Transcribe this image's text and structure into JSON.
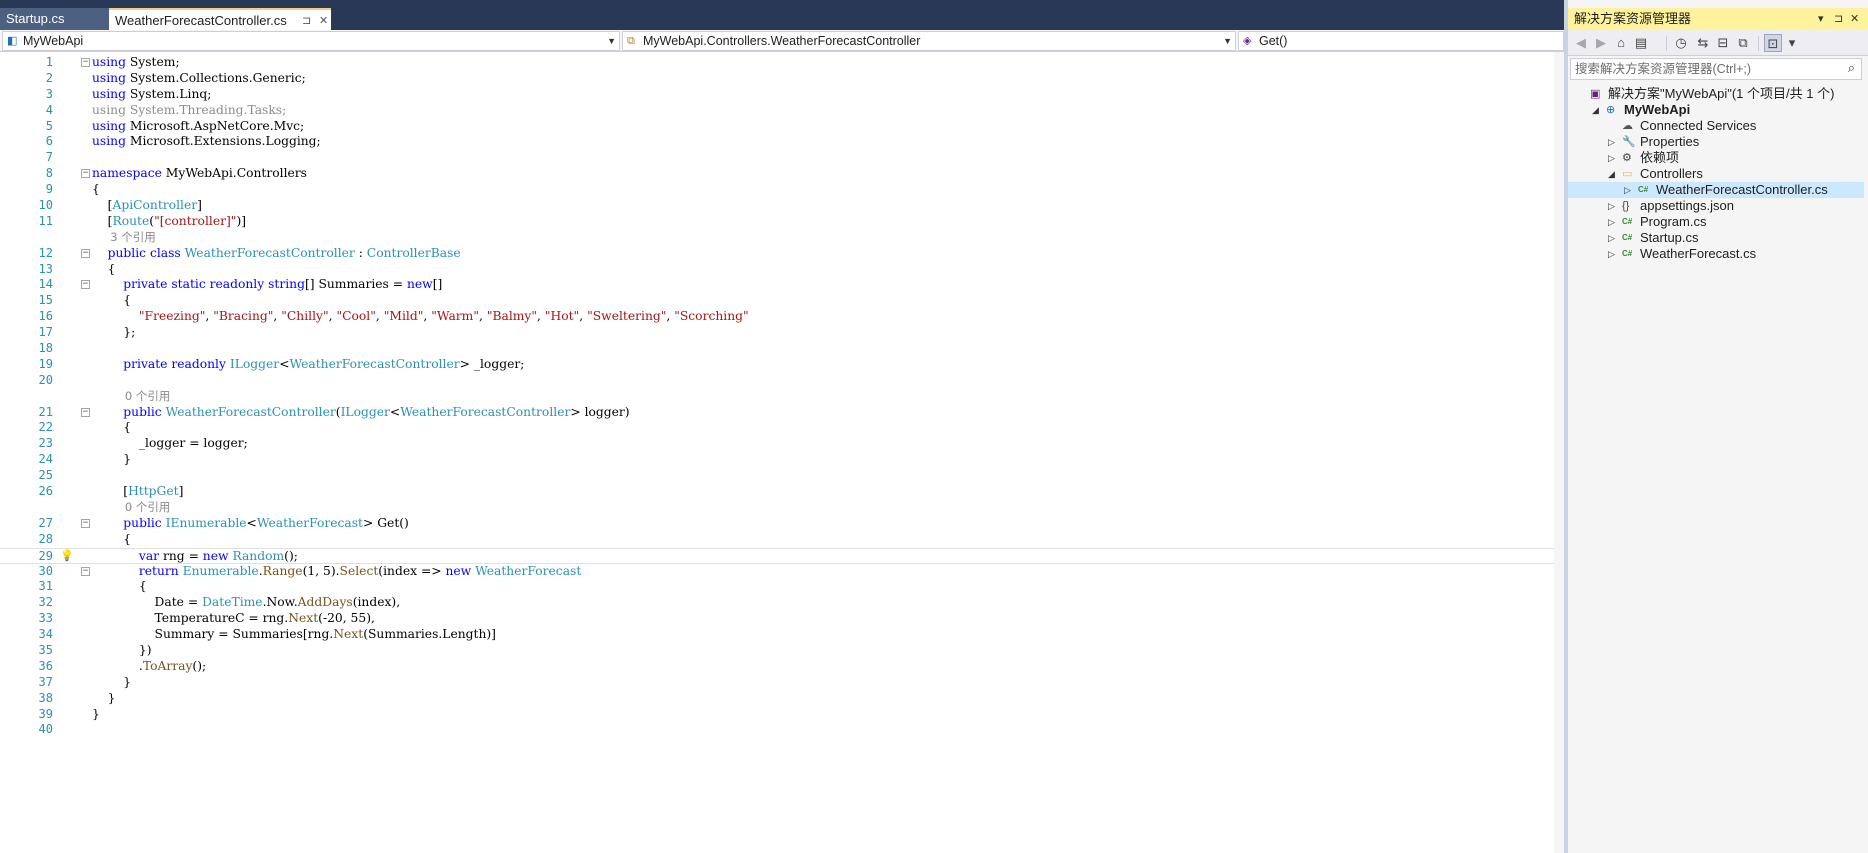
{
  "tabs": {
    "inactive": "Startup.cs",
    "active": "WeatherForecastController.cs",
    "pin_glyph": "⊐",
    "close_glyph": "✕"
  },
  "navbar": {
    "project": "MyWebApi",
    "class": "MyWebApi.Controllers.WeatherForecastController",
    "member": "Get()"
  },
  "code_lines": [
    {
      "n": "1",
      "fold": "−",
      "segs": [
        {
          "c": "kw",
          "t": "using"
        },
        {
          "c": "",
          "t": " System;"
        }
      ]
    },
    {
      "n": "2",
      "segs": [
        {
          "c": "kw",
          "t": "using"
        },
        {
          "c": "",
          "t": " System.Collections.Generic;"
        }
      ]
    },
    {
      "n": "3",
      "segs": [
        {
          "c": "kw",
          "t": "using"
        },
        {
          "c": "",
          "t": " System.Linq;"
        }
      ]
    },
    {
      "n": "4",
      "segs": [
        {
          "c": "dim",
          "t": "using System.Threading.Tasks;"
        }
      ]
    },
    {
      "n": "5",
      "segs": [
        {
          "c": "kw",
          "t": "using"
        },
        {
          "c": "",
          "t": " Microsoft.AspNetCore.Mvc;"
        }
      ]
    },
    {
      "n": "6",
      "segs": [
        {
          "c": "kw",
          "t": "using"
        },
        {
          "c": "",
          "t": " Microsoft.Extensions.Logging;"
        }
      ]
    },
    {
      "n": "7",
      "segs": []
    },
    {
      "n": "8",
      "fold": "−",
      "segs": [
        {
          "c": "kw",
          "t": "namespace"
        },
        {
          "c": "",
          "t": " MyWebApi.Controllers"
        }
      ]
    },
    {
      "n": "9",
      "segs": [
        {
          "c": "",
          "t": "{"
        }
      ]
    },
    {
      "n": "10",
      "segs": [
        {
          "c": "",
          "t": "    ["
        },
        {
          "c": "ty",
          "t": "ApiController"
        },
        {
          "c": "",
          "t": "]"
        }
      ]
    },
    {
      "n": "11",
      "segs": [
        {
          "c": "",
          "t": "    ["
        },
        {
          "c": "ty",
          "t": "Route"
        },
        {
          "c": "",
          "t": "("
        },
        {
          "c": "st",
          "t": "\"[controller]\""
        },
        {
          "c": "",
          "t": ")]"
        }
      ]
    },
    {
      "n": "",
      "lens": true,
      "segs": [
        {
          "c": "",
          "t": "     3 个引用"
        }
      ]
    },
    {
      "n": "12",
      "fold": "−",
      "segs": [
        {
          "c": "",
          "t": "    "
        },
        {
          "c": "kw",
          "t": "public class"
        },
        {
          "c": "",
          "t": " "
        },
        {
          "c": "ty",
          "t": "WeatherForecastController"
        },
        {
          "c": "",
          "t": " : "
        },
        {
          "c": "ty",
          "t": "ControllerBase"
        }
      ]
    },
    {
      "n": "13",
      "segs": [
        {
          "c": "",
          "t": "    {"
        }
      ]
    },
    {
      "n": "14",
      "fold": "−",
      "segs": [
        {
          "c": "",
          "t": "        "
        },
        {
          "c": "kw",
          "t": "private static readonly string"
        },
        {
          "c": "",
          "t": "[] Summaries = "
        },
        {
          "c": "kw",
          "t": "new"
        },
        {
          "c": "",
          "t": "[]"
        }
      ]
    },
    {
      "n": "15",
      "segs": [
        {
          "c": "",
          "t": "        {"
        }
      ]
    },
    {
      "n": "16",
      "segs": [
        {
          "c": "",
          "t": "            "
        },
        {
          "c": "st",
          "t": "\"Freezing\""
        },
        {
          "c": "",
          "t": ", "
        },
        {
          "c": "st",
          "t": "\"Bracing\""
        },
        {
          "c": "",
          "t": ", "
        },
        {
          "c": "st",
          "t": "\"Chilly\""
        },
        {
          "c": "",
          "t": ", "
        },
        {
          "c": "st",
          "t": "\"Cool\""
        },
        {
          "c": "",
          "t": ", "
        },
        {
          "c": "st",
          "t": "\"Mild\""
        },
        {
          "c": "",
          "t": ", "
        },
        {
          "c": "st",
          "t": "\"Warm\""
        },
        {
          "c": "",
          "t": ", "
        },
        {
          "c": "st",
          "t": "\"Balmy\""
        },
        {
          "c": "",
          "t": ", "
        },
        {
          "c": "st",
          "t": "\"Hot\""
        },
        {
          "c": "",
          "t": ", "
        },
        {
          "c": "st",
          "t": "\"Sweltering\""
        },
        {
          "c": "",
          "t": ", "
        },
        {
          "c": "st",
          "t": "\"Scorching\""
        }
      ]
    },
    {
      "n": "17",
      "segs": [
        {
          "c": "",
          "t": "        };"
        }
      ]
    },
    {
      "n": "18",
      "segs": []
    },
    {
      "n": "19",
      "segs": [
        {
          "c": "",
          "t": "        "
        },
        {
          "c": "kw",
          "t": "private readonly"
        },
        {
          "c": "",
          "t": " "
        },
        {
          "c": "ty",
          "t": "ILogger"
        },
        {
          "c": "",
          "t": "<"
        },
        {
          "c": "ty",
          "t": "WeatherForecastController"
        },
        {
          "c": "",
          "t": "> _logger;"
        }
      ]
    },
    {
      "n": "20",
      "segs": []
    },
    {
      "n": "",
      "lens": true,
      "segs": [
        {
          "c": "",
          "t": "         0 个引用"
        }
      ]
    },
    {
      "n": "21",
      "fold": "−",
      "segs": [
        {
          "c": "",
          "t": "        "
        },
        {
          "c": "kw",
          "t": "public"
        },
        {
          "c": "",
          "t": " "
        },
        {
          "c": "ty",
          "t": "WeatherForecastController"
        },
        {
          "c": "",
          "t": "("
        },
        {
          "c": "ty",
          "t": "ILogger"
        },
        {
          "c": "",
          "t": "<"
        },
        {
          "c": "ty",
          "t": "WeatherForecastController"
        },
        {
          "c": "",
          "t": "> logger)"
        }
      ]
    },
    {
      "n": "22",
      "segs": [
        {
          "c": "",
          "t": "        {"
        }
      ]
    },
    {
      "n": "23",
      "segs": [
        {
          "c": "",
          "t": "            _logger = logger;"
        }
      ]
    },
    {
      "n": "24",
      "segs": [
        {
          "c": "",
          "t": "        }"
        }
      ]
    },
    {
      "n": "25",
      "segs": []
    },
    {
      "n": "26",
      "segs": [
        {
          "c": "",
          "t": "        ["
        },
        {
          "c": "ty",
          "t": "HttpGet"
        },
        {
          "c": "",
          "t": "]"
        }
      ]
    },
    {
      "n": "",
      "lens": true,
      "segs": [
        {
          "c": "",
          "t": "         0 个引用"
        }
      ]
    },
    {
      "n": "27",
      "fold": "−",
      "segs": [
        {
          "c": "",
          "t": "        "
        },
        {
          "c": "kw",
          "t": "public"
        },
        {
          "c": "",
          "t": " "
        },
        {
          "c": "ty",
          "t": "IEnumerable"
        },
        {
          "c": "",
          "t": "<"
        },
        {
          "c": "ty",
          "t": "WeatherForecast"
        },
        {
          "c": "",
          "t": "> Get()"
        }
      ]
    },
    {
      "n": "28",
      "segs": [
        {
          "c": "",
          "t": "        {"
        }
      ]
    },
    {
      "n": "29",
      "current": true,
      "segs": [
        {
          "c": "",
          "t": "            "
        },
        {
          "c": "kw",
          "t": "var"
        },
        {
          "c": "",
          "t": " rng = "
        },
        {
          "c": "kw",
          "t": "new"
        },
        {
          "c": "",
          "t": " "
        },
        {
          "c": "ty",
          "t": "Random"
        },
        {
          "c": "",
          "t": "();"
        }
      ]
    },
    {
      "n": "30",
      "fold": "−",
      "segs": [
        {
          "c": "",
          "t": "            "
        },
        {
          "c": "kw",
          "t": "return"
        },
        {
          "c": "",
          "t": " "
        },
        {
          "c": "ty",
          "t": "Enumerable"
        },
        {
          "c": "",
          "t": "."
        },
        {
          "c": "fn",
          "t": "Range"
        },
        {
          "c": "",
          "t": "(1, 5)."
        },
        {
          "c": "fn",
          "t": "Select"
        },
        {
          "c": "",
          "t": "(index => "
        },
        {
          "c": "kw",
          "t": "new"
        },
        {
          "c": "",
          "t": " "
        },
        {
          "c": "ty",
          "t": "WeatherForecast"
        }
      ]
    },
    {
      "n": "31",
      "segs": [
        {
          "c": "",
          "t": "            {"
        }
      ]
    },
    {
      "n": "32",
      "segs": [
        {
          "c": "",
          "t": "                Date = "
        },
        {
          "c": "ty",
          "t": "DateTime"
        },
        {
          "c": "",
          "t": ".Now."
        },
        {
          "c": "fn",
          "t": "AddDays"
        },
        {
          "c": "",
          "t": "(index),"
        }
      ]
    },
    {
      "n": "33",
      "segs": [
        {
          "c": "",
          "t": "                TemperatureC = rng."
        },
        {
          "c": "fn",
          "t": "Next"
        },
        {
          "c": "",
          "t": "(-20, 55),"
        }
      ]
    },
    {
      "n": "34",
      "segs": [
        {
          "c": "",
          "t": "                Summary = Summaries[rng."
        },
        {
          "c": "fn",
          "t": "Next"
        },
        {
          "c": "",
          "t": "(Summaries.Length)]"
        }
      ]
    },
    {
      "n": "35",
      "segs": [
        {
          "c": "",
          "t": "            })"
        }
      ]
    },
    {
      "n": "36",
      "segs": [
        {
          "c": "",
          "t": "            ."
        },
        {
          "c": "fn",
          "t": "ToArray"
        },
        {
          "c": "",
          "t": "();"
        }
      ]
    },
    {
      "n": "37",
      "segs": [
        {
          "c": "",
          "t": "        }"
        }
      ]
    },
    {
      "n": "38",
      "segs": [
        {
          "c": "",
          "t": "    }"
        }
      ]
    },
    {
      "n": "39",
      "segs": [
        {
          "c": "",
          "t": "}"
        }
      ]
    },
    {
      "n": "40",
      "segs": []
    }
  ],
  "solution_explorer": {
    "title": "解决方案资源管理器",
    "search_placeholder": "搜索解决方案资源管理器(Ctrl+;)",
    "tree": [
      {
        "label": "解决方案\"MyWebApi\"(1 个项目/共 1 个)",
        "depth": 0,
        "arrow": "",
        "icon": "solution-icon",
        "glyph": "▣",
        "color": "#68217a"
      },
      {
        "label": "MyWebApi",
        "depth": 1,
        "arrow": "◢",
        "icon": "web-project-icon",
        "glyph": "⊕",
        "color": "#1e6fbf",
        "bold": true
      },
      {
        "label": "Connected Services",
        "depth": 2,
        "arrow": "",
        "icon": "connected-services-icon",
        "glyph": "☁",
        "color": "#555555"
      },
      {
        "label": "Properties",
        "depth": 2,
        "arrow": "▷",
        "icon": "wrench-icon",
        "glyph": "🔧",
        "color": "#424242"
      },
      {
        "label": "依赖项",
        "depth": 2,
        "arrow": "▷",
        "icon": "dependencies-icon",
        "glyph": "⚙",
        "color": "#424242"
      },
      {
        "label": "Controllers",
        "depth": 2,
        "arrow": "◢",
        "icon": "folder-open-icon",
        "glyph": "▭",
        "color": "#dcb67a"
      },
      {
        "label": "WeatherForecastController.cs",
        "depth": 3,
        "arrow": "▷",
        "icon": "csharp-file-icon",
        "glyph": "C#",
        "color": "#388a34",
        "selected": true
      },
      {
        "label": "appsettings.json",
        "depth": 2,
        "arrow": "▷",
        "icon": "json-file-icon",
        "glyph": "{}",
        "color": "#424242"
      },
      {
        "label": "Program.cs",
        "depth": 2,
        "arrow": "▷",
        "icon": "csharp-file-icon",
        "glyph": "C#",
        "color": "#388a34"
      },
      {
        "label": "Startup.cs",
        "depth": 2,
        "arrow": "▷",
        "icon": "csharp-file-icon",
        "glyph": "C#",
        "color": "#388a34"
      },
      {
        "label": "WeatherForecast.cs",
        "depth": 2,
        "arrow": "▷",
        "icon": "csharp-file-icon",
        "glyph": "C#",
        "color": "#388a34"
      }
    ]
  },
  "colors": {
    "tab_strip": "#293955",
    "title_active": "#fff29d",
    "keyword": "#0000ff",
    "type": "#2b91af",
    "string": "#a31515",
    "selection": "#cce8ff"
  }
}
